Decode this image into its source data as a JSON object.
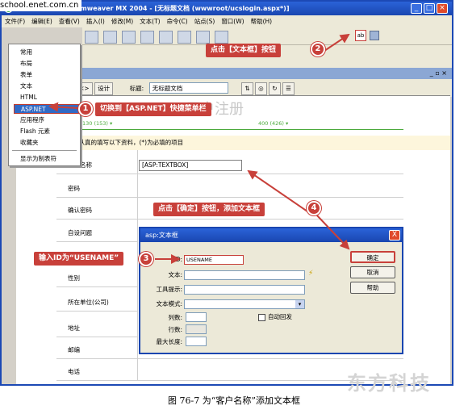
{
  "watermark": "school.enet.com.cn",
  "window": {
    "title": "Macromedia Dreamweaver MX 2004 - [无标题文档 (wwwroot/ucslogin.aspx*)]"
  },
  "menubar": [
    "文件(F)",
    "编辑(E)",
    "查看(V)",
    "插入(I)",
    "修改(M)",
    "文本(T)",
    "命令(C)",
    "站点(S)",
    "窗口(W)",
    "帮助(H)"
  ],
  "dropdown": {
    "items": [
      "常用",
      "布局",
      "表单",
      "文本",
      "HTML",
      "ASP.NET",
      "应用程序",
      "Flash 元素",
      "收藏夹",
      "显示为制表符"
    ],
    "selected": "ASP.NET"
  },
  "doc_toolbar": {
    "design_label": "设计",
    "title_label": "标题:",
    "title_value": "无标题文档"
  },
  "design_view": {
    "ruler_left": "130 (153) ▾",
    "ruler_right": "400 (426) ▾",
    "heading": "用户注册",
    "info_text": "请认真的填写以下资料，(*)为必填的项目",
    "rows": [
      "客户名称",
      "密码",
      "确认密码",
      "自设问题",
      "",
      "性别",
      "所在单位(公司)",
      "地址",
      "邮编",
      "电话"
    ],
    "asp_control": "[ASP:TEXTBOX]"
  },
  "dialog": {
    "title": "asp:文本框",
    "close": "X",
    "labels": {
      "id": "ID:",
      "text": "文本:",
      "tooltip": "工具提示:",
      "mode": "文本模式:",
      "cols": "列数:",
      "rows": "行数:",
      "maxlen": "最大长度:",
      "autopostback": "自动回发"
    },
    "id_value": "USENAME",
    "buttons": [
      "确定",
      "取消",
      "帮助"
    ]
  },
  "callouts": [
    {
      "num": "1",
      "text": "切换到【ASP.NET】快捷菜单栏"
    },
    {
      "num": "2",
      "text": "点击【文本框】按钮"
    },
    {
      "num": "3",
      "text": "输入ID为“USENAME”"
    },
    {
      "num": "4",
      "text": "点击【确定】按钮，添加文本框"
    }
  ],
  "toolbar_ab_icon": "ab",
  "brandmark": "东方科技",
  "caption": "图 76-7   为“客户名称”添加文本框",
  "colors": {
    "callout": "#c8403a",
    "titlebar": "#1a46b0",
    "ruler": "#4caa3c"
  }
}
